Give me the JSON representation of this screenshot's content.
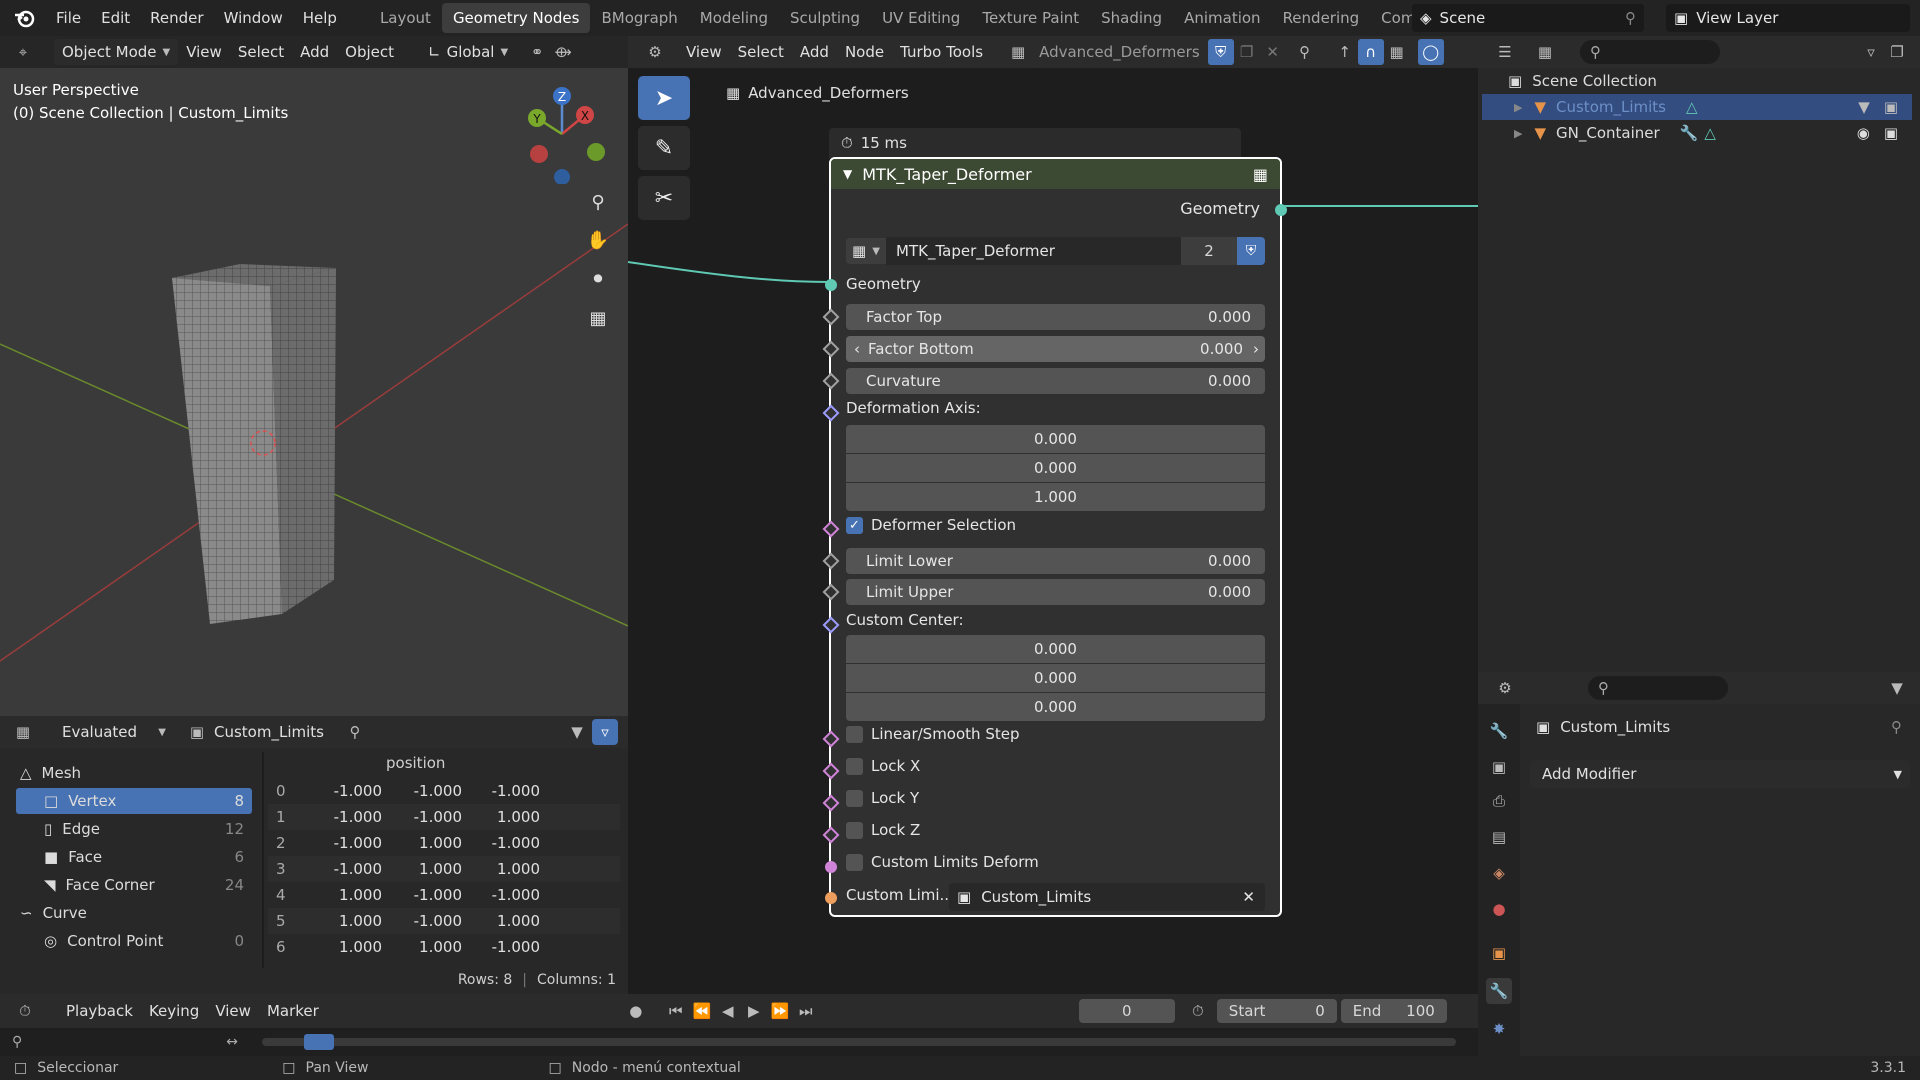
{
  "menu": [
    "File",
    "Edit",
    "Render",
    "Window",
    "Help"
  ],
  "workspaces": [
    "Layout",
    "Geometry Nodes",
    "BMograph",
    "Modeling",
    "Sculpting",
    "UV Editing",
    "Texture Paint",
    "Shading",
    "Animation",
    "Rendering",
    "Compositing"
  ],
  "active_workspace": "Geometry Nodes",
  "scene": "Scene",
  "view_layer": "View Layer",
  "viewport": {
    "mode": "Object Mode",
    "menus": [
      "View",
      "Select",
      "Add",
      "Object"
    ],
    "transform": "Global",
    "perspective": "User Perspective",
    "collection_path": "(0) Scene Collection | Custom_Limits",
    "axes": {
      "x": "X",
      "y": "Y",
      "z": "Z"
    }
  },
  "node_editor": {
    "menus": [
      "View",
      "Select",
      "Add",
      "Node",
      "Turbo Tools"
    ],
    "tree_name": "Advanced_Deformers",
    "breadcrumb": "Advanced_Deformers",
    "timing": "15 ms",
    "node": {
      "title": "MTK_Taper_Deformer",
      "output_label": "Geometry",
      "group_name": "MTK_Taper_Deformer",
      "users": "2",
      "input_geometry": "Geometry",
      "factor_top": {
        "label": "Factor Top",
        "value": "0.000"
      },
      "factor_bottom": {
        "label": "Factor Bottom",
        "value": "0.000"
      },
      "curvature": {
        "label": "Curvature",
        "value": "0.000"
      },
      "deformation_axis": {
        "label": "Deformation Axis:",
        "x": "0.000",
        "y": "0.000",
        "z": "1.000"
      },
      "deformer_selection": "Deformer Selection",
      "limit_lower": {
        "label": "Limit Lower",
        "value": "0.000"
      },
      "limit_upper": {
        "label": "Limit Upper",
        "value": "0.000"
      },
      "custom_center": {
        "label": "Custom Center:",
        "x": "0.000",
        "y": "0.000",
        "z": "0.000"
      },
      "linear_smooth": "Linear/Smooth Step",
      "lock_x": "Lock X",
      "lock_y": "Lock Y",
      "lock_z": "Lock Z",
      "custom_limits_deform": "Custom Limits Deform",
      "custom_limits_label": "Custom Limi...",
      "custom_limits_object": "Custom_Limits"
    }
  },
  "outliner": {
    "root": "Scene Collection",
    "items": [
      {
        "name": "Custom_Limits"
      },
      {
        "name": "GN_Container"
      }
    ]
  },
  "properties": {
    "object": "Custom_Limits",
    "add_modifier": "Add Modifier"
  },
  "spreadsheet": {
    "mode": "Evaluated",
    "object": "Custom_Limits",
    "column": "position",
    "tree": [
      {
        "label": "Mesh",
        "count": ""
      },
      {
        "label": "Vertex",
        "count": "8"
      },
      {
        "label": "Edge",
        "count": "12"
      },
      {
        "label": "Face",
        "count": "6"
      },
      {
        "label": "Face Corner",
        "count": "24"
      },
      {
        "label": "Curve",
        "count": ""
      },
      {
        "label": "Control Point",
        "count": "0"
      }
    ],
    "rows": [
      [
        "0",
        "-1.000",
        "-1.000",
        "-1.000"
      ],
      [
        "1",
        "-1.000",
        "-1.000",
        "1.000"
      ],
      [
        "2",
        "-1.000",
        "1.000",
        "-1.000"
      ],
      [
        "3",
        "-1.000",
        "1.000",
        "1.000"
      ],
      [
        "4",
        "1.000",
        "-1.000",
        "-1.000"
      ],
      [
        "5",
        "1.000",
        "-1.000",
        "1.000"
      ],
      [
        "6",
        "1.000",
        "1.000",
        "-1.000"
      ]
    ],
    "footer_rows": "Rows: 8",
    "footer_cols": "Columns: 1"
  },
  "timeline": {
    "menus": [
      "Playback",
      "Keying",
      "View",
      "Marker"
    ],
    "frame": "0",
    "start_label": "Start",
    "start": "0",
    "end_label": "End",
    "end": "100"
  },
  "status": {
    "select": "Seleccionar",
    "pan": "Pan View",
    "context": "Nodo - menú contextual",
    "version": "3.3.1"
  }
}
